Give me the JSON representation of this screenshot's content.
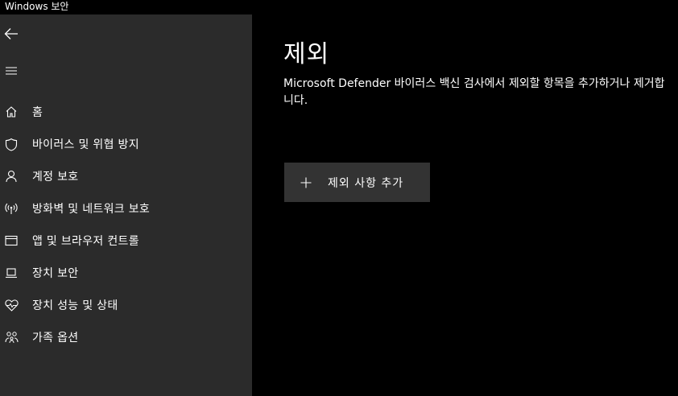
{
  "window": {
    "title": "Windows 보안"
  },
  "sidebar": {
    "back_icon": "back-arrow-icon",
    "menu_icon": "hamburger-icon",
    "items": [
      {
        "label": "홈",
        "icon": "home-icon"
      },
      {
        "label": "바이러스 및 위협 방지",
        "icon": "shield-icon"
      },
      {
        "label": "계정 보호",
        "icon": "person-icon"
      },
      {
        "label": "방화벽 및 네트워크 보호",
        "icon": "wifi-antenna-icon"
      },
      {
        "label": "앱 및 브라우저 컨트롤",
        "icon": "app-window-icon"
      },
      {
        "label": "장치 보안",
        "icon": "laptop-icon"
      },
      {
        "label": "장치 성능 및 상태",
        "icon": "heart-pulse-icon"
      },
      {
        "label": "가족 옵션",
        "icon": "family-icon"
      }
    ]
  },
  "main": {
    "title": "제외",
    "description": "Microsoft Defender 바이러스 백신 검사에서 제외할 항목을 추가하거나 제거합니다.",
    "add_button": {
      "label": "제외 사항 추가",
      "icon": "plus-icon"
    }
  },
  "colors": {
    "background": "#000000",
    "sidebar": "#2b2b2b",
    "button": "#333333",
    "text": "#ffffff"
  }
}
